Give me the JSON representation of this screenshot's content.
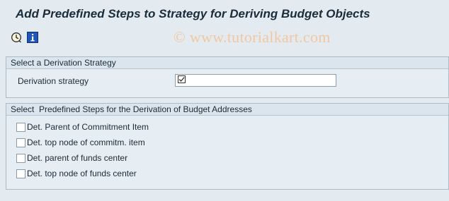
{
  "window": {
    "title": "Add Predefined Steps to Strategy for Deriving Budget Objects"
  },
  "toolbar": {
    "buttons": [
      {
        "icon": "execute-clock-icon"
      },
      {
        "icon": "info-icon"
      }
    ]
  },
  "watermark": "© www.tutorialkart.com",
  "strategy_group": {
    "header": "Select a Derivation Strategy",
    "field_label": "Derivation strategy",
    "field_value": ""
  },
  "steps_group": {
    "header": "Select  Predefined Steps for the Derivation of Budget Addresses",
    "items": [
      {
        "label": "Det. Parent of Commitment Item",
        "checked": false
      },
      {
        "label": "Det. top node of commitm. item",
        "checked": false
      },
      {
        "label": "Det. parent of funds center",
        "checked": false
      },
      {
        "label": "Det. top node of funds center",
        "checked": false
      }
    ]
  }
}
